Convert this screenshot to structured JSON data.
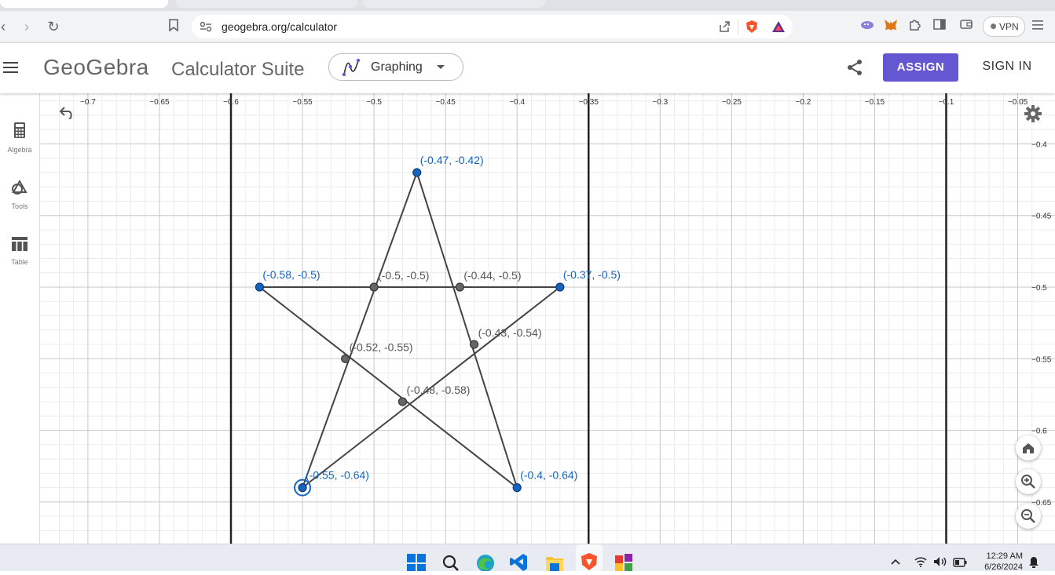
{
  "browser": {
    "url": "geogebra.org/calculator",
    "vpn_label": "VPN"
  },
  "header": {
    "logo": "GeoGebra",
    "suite_title": "Calculator Suite",
    "app_selector": "Graphing",
    "assign_label": "ASSIGN",
    "signin_label": "SIGN IN"
  },
  "sidebar": {
    "items": [
      {
        "label": "Algebra",
        "icon": "calculator-icon"
      },
      {
        "label": "Tools",
        "icon": "shapes-icon"
      },
      {
        "label": "Table",
        "icon": "table-icon"
      }
    ]
  },
  "graph": {
    "x_ticks": [
      "-0.7",
      "-0.65",
      "-0.6",
      "-0.55",
      "-0.5",
      "-0.45",
      "-0.4",
      "-0.35",
      "-0.3",
      "-0.25",
      "-0.2",
      "-0.15",
      "-0.1",
      "-0.05"
    ],
    "y_ticks": [
      "-0.4",
      "-0.45",
      "-0.5",
      "-0.55",
      "-0.6",
      "-0.65"
    ],
    "vertical_lines_x": [
      -0.6,
      -0.35,
      -0.1
    ],
    "outer_points": [
      {
        "x": -0.47,
        "y": -0.42,
        "label": "(-0.47, -0.42)"
      },
      {
        "x": -0.58,
        "y": -0.5,
        "label": "(-0.58, -0.5)"
      },
      {
        "x": -0.37,
        "y": -0.5,
        "label": "(-0.37, -0.5)"
      },
      {
        "x": -0.55,
        "y": -0.64,
        "label": "(-0.55, -0.64)"
      },
      {
        "x": -0.4,
        "y": -0.64,
        "label": "(-0.4, -0.64)"
      }
    ],
    "inner_points": [
      {
        "x": -0.5,
        "y": -0.5,
        "label": "(-0.5, -0.5)"
      },
      {
        "x": -0.44,
        "y": -0.5,
        "label": "(-0.44, -0.5)"
      },
      {
        "x": -0.52,
        "y": -0.55,
        "label": "(-0.52, -0.55)"
      },
      {
        "x": -0.43,
        "y": -0.54,
        "label": "(-0.43, -0.54)"
      },
      {
        "x": -0.48,
        "y": -0.58,
        "label": "(-0.48, -0.58)"
      }
    ],
    "segments": [
      [
        [
          -0.47,
          -0.42
        ],
        [
          -0.55,
          -0.64
        ]
      ],
      [
        [
          -0.47,
          -0.42
        ],
        [
          -0.4,
          -0.64
        ]
      ],
      [
        [
          -0.58,
          -0.5
        ],
        [
          -0.37,
          -0.5
        ]
      ],
      [
        [
          -0.58,
          -0.5
        ],
        [
          -0.4,
          -0.64
        ]
      ],
      [
        [
          -0.37,
          -0.5
        ],
        [
          -0.55,
          -0.64
        ]
      ]
    ],
    "selected_point": "(-0.55, -0.64)",
    "colors": {
      "point_blue": "#1565c0",
      "point_gray": "#555555",
      "line": "#444444",
      "axis_line": "#222222"
    }
  },
  "taskbar": {
    "time": "12:29 AM",
    "date": "6/26/2024"
  }
}
